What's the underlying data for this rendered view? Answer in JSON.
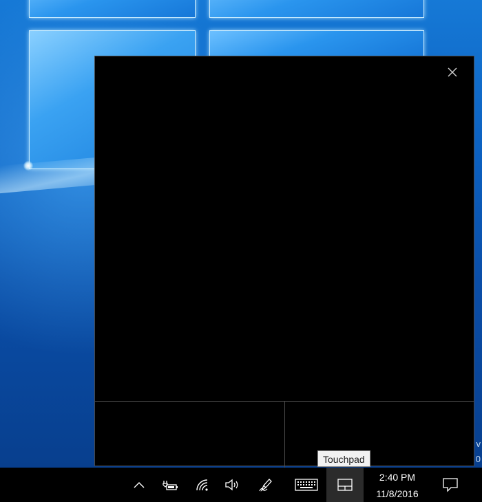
{
  "desktop": {
    "edge_text_1": "v",
    "edge_text_2": "0"
  },
  "touchpad": {
    "close_icon": "close-icon"
  },
  "tooltip": {
    "text": "Touchpad"
  },
  "taskbar": {
    "icons": [
      "chevron-up-icon",
      "battery-icon",
      "wifi-icon",
      "volume-icon",
      "pen-icon",
      "keyboard-icon",
      "touchpad-icon",
      "notification-icon"
    ],
    "time": "2:40 PM",
    "date": "11/8/2016"
  },
  "colors": {
    "taskbar": "#000000",
    "touchpad_bg": "#000000",
    "active_tray": "#2b2b2b",
    "wallpaper_blue": "#0b5fbf"
  }
}
